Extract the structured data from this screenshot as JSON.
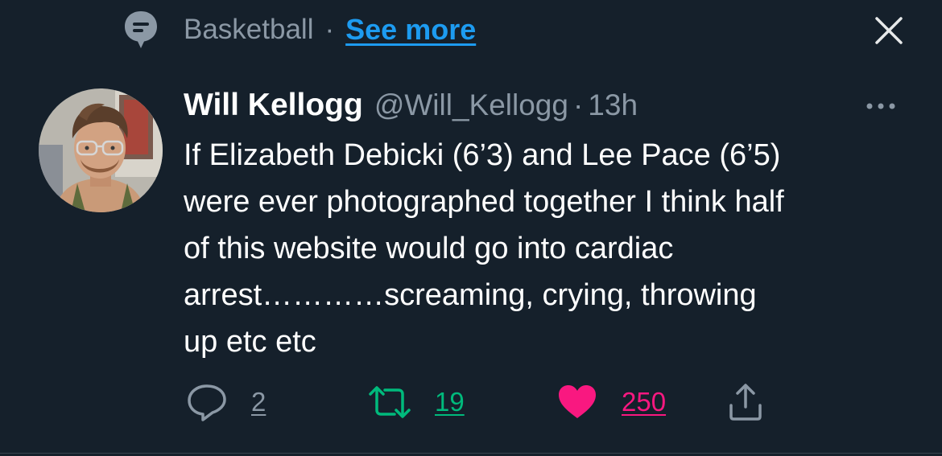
{
  "topic": {
    "label": "Basketball",
    "separator": "·",
    "see_more": "See more",
    "icon": "topic-bubble-icon"
  },
  "close": {
    "icon": "close-icon"
  },
  "tweet": {
    "author": {
      "name": "Will Kellogg",
      "handle": "@Will_Kellogg"
    },
    "separator": "·",
    "time": "13h",
    "more_icon": "more-icon",
    "lines": [
      "If Elizabeth Debicki (6’3) and Lee Pace (6’5)",
      "were ever photographed together I think half",
      "of this website would go into cardiac",
      "arrest…………screaming, crying, throwing",
      "up etc etc"
    ],
    "actions": {
      "replies": "2",
      "retweets": "19",
      "likes": "250"
    }
  },
  "colors": {
    "background": "#15202b",
    "secondary_text": "#8b98a5",
    "link": "#1d9bf0",
    "retweet": "#00ba7c",
    "like": "#f91880"
  }
}
